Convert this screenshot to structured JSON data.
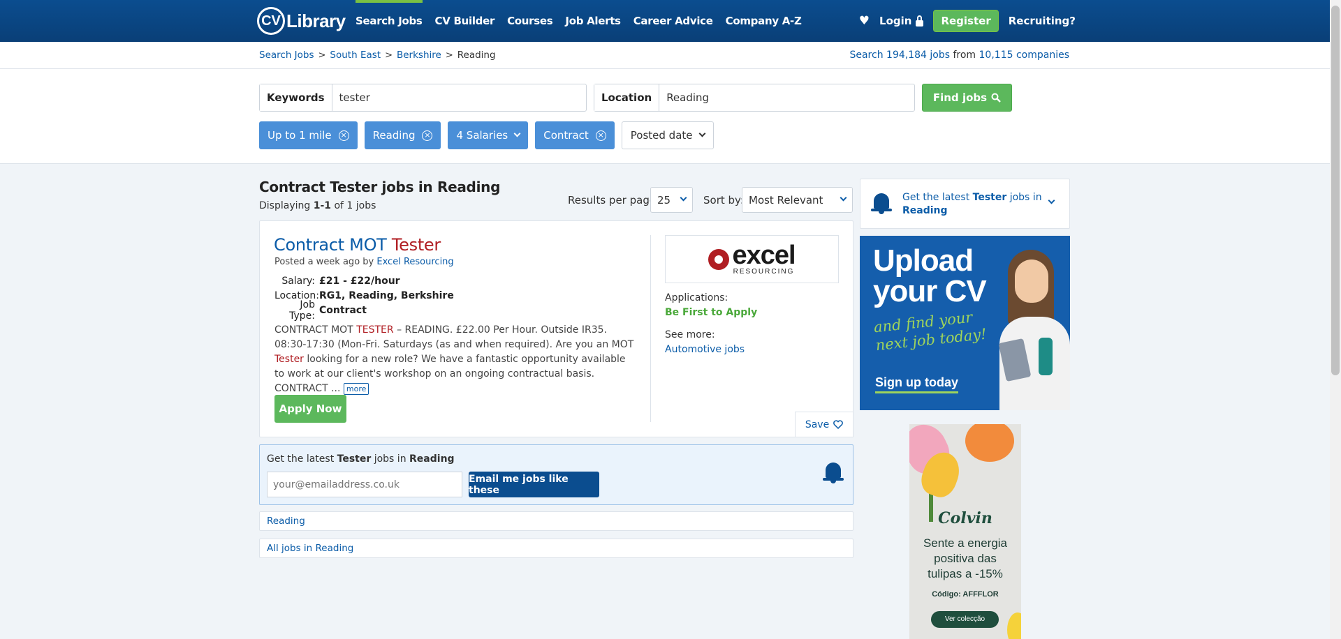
{
  "header": {
    "logo_cv": "CV",
    "logo_library": "Library",
    "nav": [
      "Search Jobs",
      "CV Builder",
      "Courses",
      "Job Alerts",
      "Career Advice",
      "Company A-Z"
    ],
    "login": "Login",
    "register": "Register",
    "recruiting": "Recruiting?"
  },
  "breadcrumb": {
    "items": [
      "Search Jobs",
      "South East",
      "Berkshire"
    ],
    "current": "Reading"
  },
  "stats": {
    "prefix": "Search",
    "jobs": "194,184 jobs",
    "from": "from",
    "companies": "10,115 companies"
  },
  "search": {
    "keywords_label": "Keywords",
    "keywords_value": "tester",
    "location_label": "Location",
    "location_value": "Reading",
    "find_label": "Find jobs"
  },
  "filters": {
    "distance": "Up to 1 mile",
    "location": "Reading",
    "salaries": "4 Salaries",
    "type": "Contract",
    "posted": "Posted date"
  },
  "results": {
    "title": "Contract Tester jobs in Reading",
    "displaying_prefix": "Displaying",
    "displaying_range": "1-1",
    "displaying_suffix": "of 1 jobs",
    "rpp_label": "Results per page:",
    "rpp_value": "25",
    "sort_label": "Sort by:",
    "sort_value": "Most Relevant"
  },
  "job": {
    "title_a": "Contract MOT",
    "title_b": "Tester",
    "posted": "Posted a week ago by",
    "company": "Excel Resourcing",
    "salary_label": "Salary:",
    "salary": "£21 - £22/hour",
    "location_label": "Location:",
    "location": "RG1, Reading, Berkshire",
    "type_label": "Job Type:",
    "type": "Contract",
    "desc_1": "CONTRACT MOT",
    "desc_hl1": "TESTER",
    "desc_2": "– READING. £22.00 Per Hour. Outside IR35. 08:30-17:30 (Mon-Fri. Saturdays (as and when required). Are you an MOT",
    "desc_hl2": "Tester",
    "desc_3": "looking for a new role? We have a fantastic opportunity available to work at our client's workshop on an ongoing contractual basis. CONTRACT ...",
    "more": "more",
    "apply": "Apply Now",
    "logo_main": "excel",
    "logo_sub": "RESOURCING",
    "applications_label": "Applications:",
    "applications_value": "Be First to Apply",
    "seemore_label": "See more:",
    "seemore_link": "Automotive jobs",
    "save": "Save"
  },
  "alert": {
    "text_a": "Get the latest",
    "text_b": "Tester",
    "text_c": "jobs in",
    "text_d": "Reading",
    "placeholder": "your@emailaddress.co.uk",
    "button": "Email me jobs like these"
  },
  "links": [
    "Reading",
    "All jobs in Reading"
  ],
  "side_alert": {
    "a": "Get the latest",
    "b": "Tester",
    "c": "jobs in",
    "d": "Reading"
  },
  "ad_cv": {
    "line1": "Upload",
    "line2": "your CV",
    "sub1": "and find your",
    "sub2": "next job today!",
    "cta": "Sign up today"
  },
  "ad_tulip": {
    "brand": "Colvin",
    "copy1": "Sente a energia",
    "copy2": "positiva das",
    "copy3": "tulipas a -15%",
    "code": "Código: AFFFLOR",
    "button": "Ver colecção"
  },
  "colors": {
    "header": "#0b4d8f",
    "accent_green": "#5cb85c",
    "link_blue": "#0b5ca8",
    "highlight_red": "#b01e23",
    "chip_blue": "#4a8fd8"
  }
}
